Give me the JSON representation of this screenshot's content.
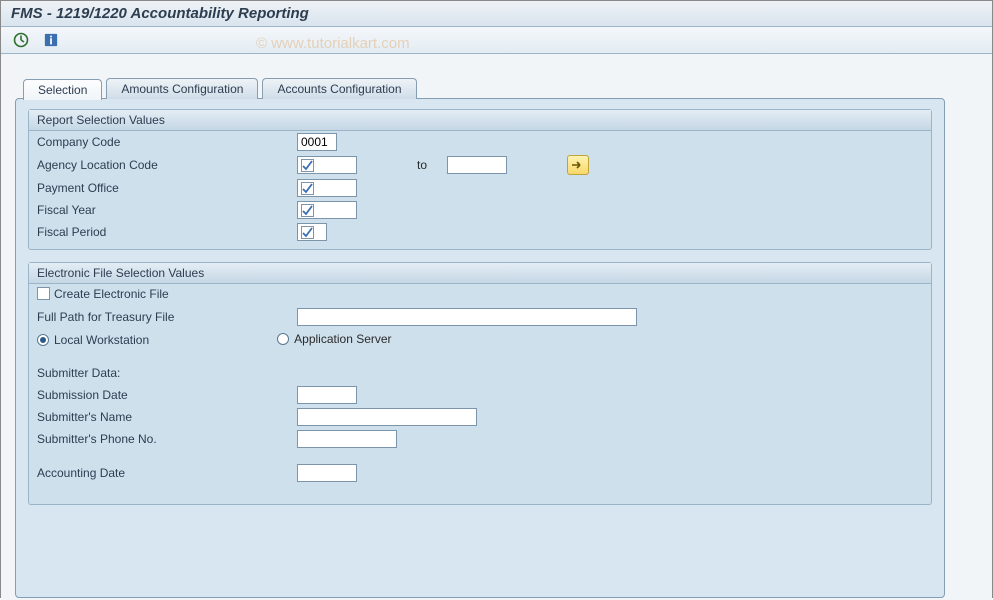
{
  "window": {
    "title": "FMS - 1219/1220 Accountability Reporting"
  },
  "watermark": "© www.tutorialkart.com",
  "tabs": {
    "selection": "Selection",
    "amounts": "Amounts Configuration",
    "accounts": "Accounts Configuration"
  },
  "group1": {
    "title": "Report Selection Values",
    "company_code_label": "Company Code",
    "company_code_value": "0001",
    "agency_loc_label": "Agency Location Code",
    "agency_loc_to": "to",
    "payment_office_label": "Payment Office",
    "fiscal_year_label": "Fiscal Year",
    "fiscal_period_label": "Fiscal Period"
  },
  "group2": {
    "title": "Electronic File Selection Values",
    "create_file_label": "Create Electronic File",
    "full_path_label": "Full Path for Treasury File",
    "local_ws_label": "Local Workstation",
    "app_server_label": "Application Server",
    "submitter_header": "Submitter Data:",
    "submission_date_label": "Submission Date",
    "submitter_name_label": "Submitter's Name",
    "submitter_phone_label": "Submitter's Phone No.",
    "accounting_date_label": "Accounting Date"
  }
}
